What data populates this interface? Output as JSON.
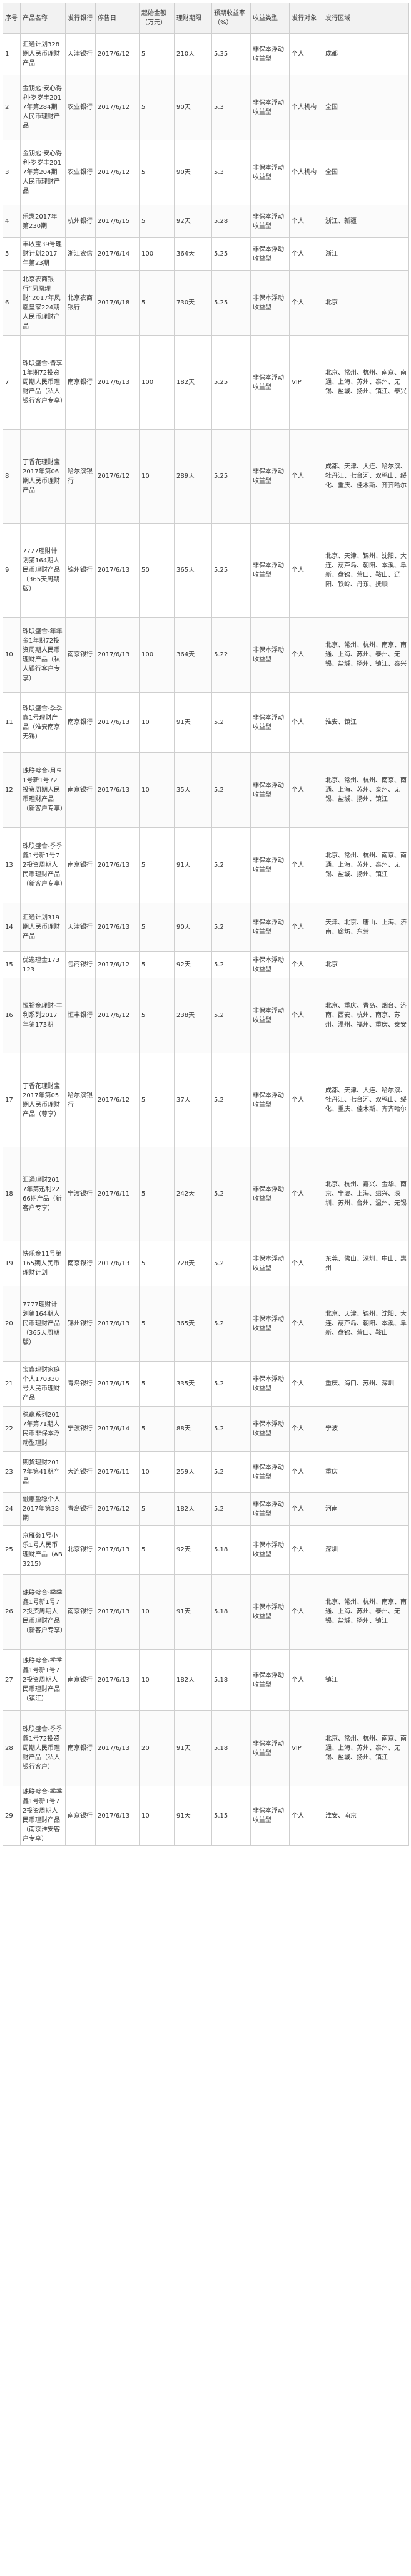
{
  "table": {
    "headers": [
      "序号",
      "产品名称",
      "发行银行",
      "停售日",
      "起始金额（万元）",
      "理财期限",
      "预期收益率（%）",
      "收益类型",
      "发行对象",
      "发行区域"
    ],
    "rows": [
      {
        "cells": [
          "1",
          "汇通计划328期人民币理财产品",
          "天津银行",
          "2017/6/12",
          "5",
          "210天",
          "5.35",
          "非保本浮动收益型",
          "个人",
          "成都"
        ],
        "h": 66
      },
      {
        "cells": [
          "2",
          "金钥匙·安心得利·岁岁丰2017年第284期人民币理财产品",
          "农业银行",
          "2017/6/12",
          "5",
          "90天",
          "5.3",
          "非保本浮动收益型",
          "个人机构",
          "全国"
        ],
        "h": 104
      },
      {
        "cells": [
          "3",
          "金钥匙·安心得利·岁岁丰2017年第204期人民币理财产品",
          "农业银行",
          "2017/6/12",
          "5",
          "90天",
          "5.3",
          "非保本浮动收益型",
          "个人机构",
          "全国"
        ],
        "h": 104
      },
      {
        "cells": [
          "4",
          "乐惠2017年第230期",
          "杭州银行",
          "2017/6/15",
          "5",
          "92天",
          "5.28",
          "非保本浮动收益型",
          "个人",
          "浙江、新疆"
        ],
        "h": 52
      },
      {
        "cells": [
          "5",
          "丰收宝39号理财计划2017年第23期",
          "浙江农信",
          "2017/6/14",
          "100",
          "364天",
          "5.25",
          "非保本浮动收益型",
          "个人",
          "浙江"
        ],
        "h": 52
      },
      {
        "cells": [
          "6",
          "北京农商银行“凤凰理财”2017年凤凰皇家224期人民币理财产品",
          "北京农商银行",
          "2017/6/18",
          "5",
          "730天",
          "5.25",
          "非保本浮动收益型",
          "个人",
          "北京"
        ],
        "h": 104
      },
      {
        "cells": [
          "7",
          "珠联璧合-晋享1年期72投资周期人民币理财产品（私人银行客户专享）",
          "南京银行",
          "2017/6/13",
          "100",
          "182天",
          "5.25",
          "非保本浮动收益型",
          "VIP",
          "北京、常州、杭州、南京、南通、上海、苏州、泰州、无锡、盐城、扬州、镇江、泰兴"
        ],
        "h": 150
      },
      {
        "cells": [
          "8",
          "丁香花理财宝2017年第06期人民币理财产品",
          "哈尔滨银行",
          "2017/6/12",
          "10",
          "289天",
          "5.25",
          "非保本浮动收益型",
          "个人",
          "成都、天津、大连、哈尔滨、牡丹江、七台河、双鸭山、绥化、重庆、佳木斯、齐齐哈尔"
        ],
        "h": 150
      },
      {
        "cells": [
          "9",
          "7777理财计划第164期人民币理财产品（365天周期版）",
          "锦州银行",
          "2017/6/13",
          "50",
          "365天",
          "5.25",
          "非保本浮动收益型",
          "个人",
          "北京、天津、锦州、沈阳、大连、葫芦岛、朝阳、本溪、阜新、盘锦、营口、鞍山、辽阳、铁岭、丹东、抚顺"
        ],
        "h": 150
      },
      {
        "cells": [
          "10",
          "珠联璧合-年年金1年期72投资周期人民币理财产品（私人银行客户专享）",
          "南京银行",
          "2017/6/13",
          "100",
          "364天",
          "5.22",
          "非保本浮动收益型",
          "个人",
          "北京、常州、杭州、南京、南通、上海、苏州、泰州、无锡、盐城、扬州、镇江、泰兴"
        ],
        "h": 120
      },
      {
        "cells": [
          "11",
          "珠联璧合-季季鑫1号理财产品（淮安南京无锡）",
          "南京银行",
          "2017/6/13",
          "10",
          "91天",
          "5.2",
          "非保本浮动收益型",
          "个人",
          "淮安、镇江"
        ],
        "h": 96
      },
      {
        "cells": [
          "12",
          "珠联璧合-月享1号新1号72投资周期人民币理财产品（新客户专享）",
          "南京银行",
          "2017/6/13",
          "10",
          "35天",
          "5.2",
          "非保本浮动收益型",
          "个人",
          "北京、常州、杭州、南京、南通、上海、苏州、泰州、无锡、盐城、扬州、镇江"
        ],
        "h": 120
      },
      {
        "cells": [
          "13",
          "珠联璧合-季季鑫1号新1号72投资周期人民币理财产品（新客户专享）",
          "南京银行",
          "2017/6/13",
          "5",
          "91天",
          "5.2",
          "非保本浮动收益型",
          "个人",
          "北京、常州、杭州、南京、南通、上海、苏州、泰州、无锡、盐城、扬州、镇江"
        ],
        "h": 120
      },
      {
        "cells": [
          "14",
          "汇通计划319期人民币理财产品",
          "天津银行",
          "2017/6/13",
          "5",
          "90天",
          "5.2",
          "非保本浮动收益型",
          "个人",
          "天津、北京、唐山、上海、济南、廊坊、东营"
        ],
        "h": 78
      },
      {
        "cells": [
          "15",
          "优逸理金173123",
          "包商银行",
          "2017/6/12",
          "5",
          "92天",
          "5.2",
          "非保本浮动收益型",
          "个人",
          "北京"
        ],
        "h": 42
      },
      {
        "cells": [
          "16",
          "恒裕金理财-丰利系列2017年第173期",
          "恒丰银行",
          "2017/6/12",
          "5",
          "238天",
          "5.2",
          "非保本浮动收益型",
          "个人",
          "北京、重庆、青岛、烟台、济南、西安、杭州、南京、苏州、温州、福州、重庆、泰安"
        ],
        "h": 120
      },
      {
        "cells": [
          "17",
          "丁香花理财宝2017年第05期人民币理财产品（尊享）",
          "哈尔滨银行",
          "2017/6/12",
          "5",
          "37天",
          "5.2",
          "非保本浮动收益型",
          "个人",
          "成都、天津、大连、哈尔滨、牡丹江、七台河、双鸭山、绥化、重庆、佳木斯、齐齐哈尔"
        ],
        "h": 150
      },
      {
        "cells": [
          "18",
          "汇通理财2017年第迅利2266期产品（新客户专享）",
          "宁波银行",
          "2017/6/11",
          "5",
          "242天",
          "5.2",
          "非保本浮动收益型",
          "个人",
          "北京、杭州、嘉兴、金华、南京、宁波、上海、绍兴、深圳、苏州、台州、温州、无锡"
        ],
        "h": 150
      },
      {
        "cells": [
          "19",
          "快乐金11号第165期人民币理财计划",
          "南京银行",
          "2017/6/13",
          "5",
          "728天",
          "5.2",
          "非保本浮动收益型",
          "个人",
          "东莞、佛山、深圳、中山、惠州"
        ],
        "h": 72
      },
      {
        "cells": [
          "20",
          "7777理财计划第164期人民币理财产品（365天周期版）",
          "锦州银行",
          "2017/6/13",
          "5",
          "365天",
          "5.2",
          "非保本浮动收益型",
          "个人",
          "北京、天津、锦州、沈阳、大连、葫芦岛、朝阳、本溪、阜新、盘锦、营口、鞍山"
        ],
        "h": 120
      },
      {
        "cells": [
          "21",
          "宝鑫理财家庭个人170330号人民币理财产品",
          "青岛银行",
          "2017/6/15",
          "5",
          "335天",
          "5.2",
          "非保本浮动收益型",
          "个人",
          "重庆、海口、苏州、深圳"
        ],
        "h": 72
      },
      {
        "cells": [
          "22",
          "稳赢系列2017年第71期人民币非保本浮动型理财",
          "宁波银行",
          "2017/6/14",
          "5",
          "88天",
          "5.2",
          "非保本浮动收益型",
          "个人",
          "宁波"
        ],
        "h": 72
      },
      {
        "cells": [
          "23",
          "期货理财2017年第41期产品",
          "大连银行",
          "2017/6/11",
          "10",
          "259天",
          "5.2",
          "非保本浮动收益型",
          "个人",
          "重庆"
        ],
        "h": 66
      },
      {
        "cells": [
          "24",
          "融惠盈稳个人2017年第38期",
          "青岛银行",
          "2017/6/12",
          "5",
          "182天",
          "5.2",
          "非保本浮动收益型",
          "个人",
          "河南"
        ],
        "h": 52
      },
      {
        "cells": [
          "25",
          "京雁荟1号小乐1号人民币理财产品（AB3215）",
          "北京银行",
          "2017/6/13",
          "5",
          "92天",
          "5.18",
          "非保本浮动收益型",
          "个人",
          "深圳"
        ],
        "h": 78
      },
      {
        "cells": [
          "26",
          "珠联璧合-季季鑫1号新1号72投资周期人民币理财产品（新客户专享）",
          "南京银行",
          "2017/6/13",
          "10",
          "91天",
          "5.18",
          "非保本浮动收益型",
          "个人",
          "北京、常州、杭州、南京、南通、上海、苏州、泰州、无锡、盐城、扬州、镇江"
        ],
        "h": 120
      },
      {
        "cells": [
          "27",
          "珠联璧合-季季鑫1号新1号72投资周期人民币理财产品（镇江）",
          "南京银行",
          "2017/6/13",
          "10",
          "182天",
          "5.18",
          "非保本浮动收益型",
          "个人",
          "镇江"
        ],
        "h": 98
      },
      {
        "cells": [
          "28",
          "珠联璧合-季季鑫1号72投资周期人民币理财产品（私人银行客户）",
          "南京银行",
          "2017/6/13",
          "20",
          "91天",
          "5.18",
          "非保本浮动收益型",
          "VIP",
          "北京、常州、杭州、南京、南通、上海、苏州、泰州、无锡、盐城、扬州、镇江"
        ],
        "h": 120
      },
      {
        "cells": [
          "29",
          "珠联璧合-季季鑫1号新1号72投资周期人民币理财产品（南京淮安客户专享）",
          "南京银行",
          "2017/6/13",
          "10",
          "91天",
          "5.15",
          "非保本浮动收益型",
          "个人",
          "淮安、南京"
        ],
        "h": 70
      }
    ]
  }
}
